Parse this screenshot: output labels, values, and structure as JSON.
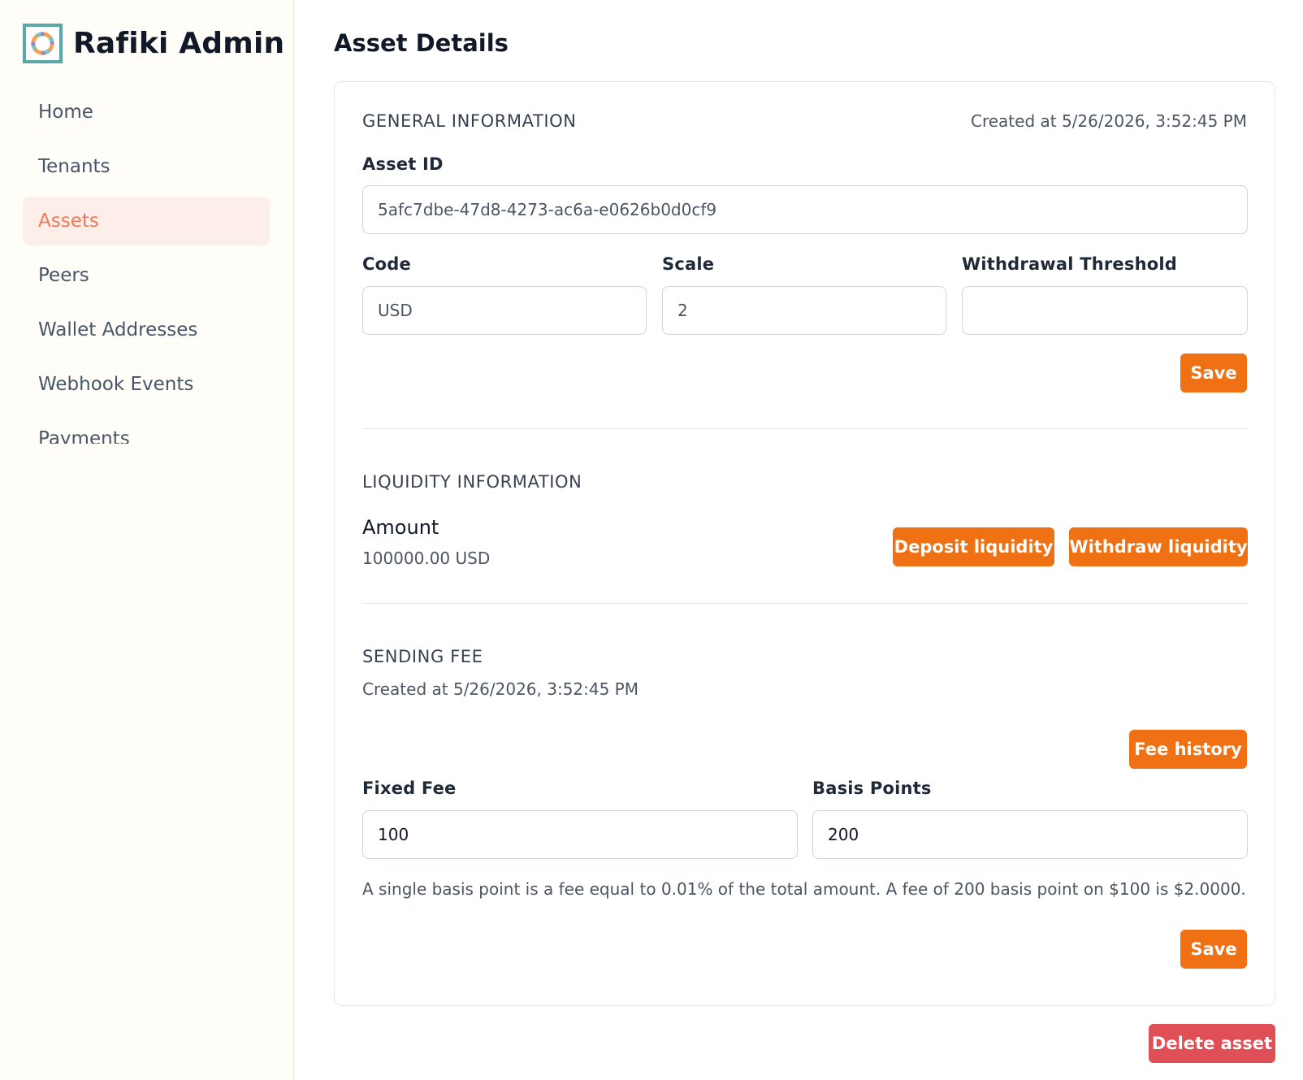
{
  "app": {
    "title": "Rafiki Admin",
    "logo_icon": "rafiki-ring-logo"
  },
  "sidebar": {
    "items": [
      {
        "label": "Home",
        "active": false
      },
      {
        "label": "Tenants",
        "active": false
      },
      {
        "label": "Assets",
        "active": true
      },
      {
        "label": "Peers",
        "active": false
      },
      {
        "label": "Wallet Addresses",
        "active": false
      },
      {
        "label": "Webhook Events",
        "active": false
      },
      {
        "label": "Payments",
        "active": false
      }
    ]
  },
  "page": {
    "title": "Asset Details"
  },
  "general": {
    "title": "GENERAL INFORMATION",
    "created_at": "Created at 5/26/2026, 3:52:45 PM",
    "asset_id_label": "Asset ID",
    "asset_id_value": "5afc7dbe-47d8-4273-ac6a-e0626b0d0cf9",
    "code_label": "Code",
    "code_value": "USD",
    "scale_label": "Scale",
    "scale_value": "2",
    "threshold_label": "Withdrawal Threshold",
    "threshold_value": "",
    "save_label": "Save"
  },
  "liquidity": {
    "title": "LIQUIDITY INFORMATION",
    "amount_label": "Amount",
    "amount_value": "100000.00 USD",
    "deposit_label": "Deposit liquidity",
    "withdraw_label": "Withdraw liquidity"
  },
  "fee": {
    "title": "SENDING FEE",
    "created_at": "Created at 5/26/2026, 3:52:45 PM",
    "history_label": "Fee history",
    "fixed_label": "Fixed Fee",
    "fixed_value": "100",
    "basis_label": "Basis Points",
    "basis_value": "200",
    "help_text": "A single basis point is a fee equal to 0.01% of the total amount. A fee of 200 basis point on $100 is $2.0000.",
    "save_label": "Save"
  },
  "actions": {
    "delete_label": "Delete asset"
  },
  "colors": {
    "accent": "#f07014",
    "danger": "#e04f55",
    "active_nav_bg": "#fdeee9",
    "active_nav_text": "#ef7a55"
  }
}
